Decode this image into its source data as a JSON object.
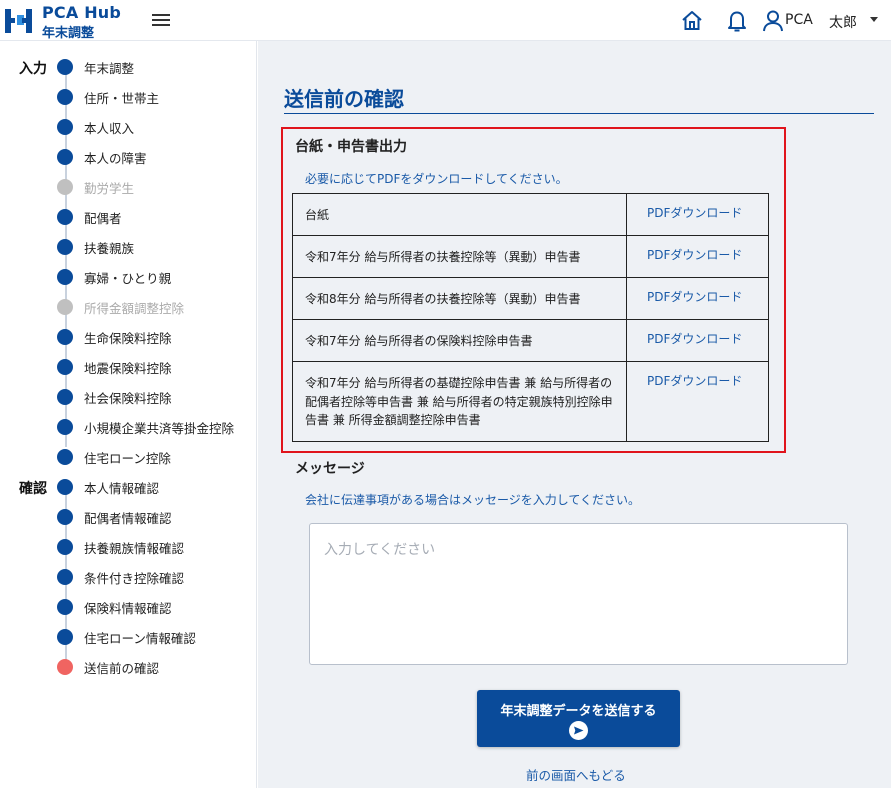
{
  "header": {
    "brand_title": "PCA Hub",
    "brand_sub": "年末調整",
    "user_name": "PCA",
    "user_role": "太郎"
  },
  "sidebar": {
    "section_input": "入力",
    "section_confirm": "確認",
    "input_steps": [
      {
        "label": "年末調整",
        "state": "done"
      },
      {
        "label": "住所・世帯主",
        "state": "done"
      },
      {
        "label": "本人収入",
        "state": "done"
      },
      {
        "label": "本人の障害",
        "state": "done"
      },
      {
        "label": "勤労学生",
        "state": "disabled"
      },
      {
        "label": "配偶者",
        "state": "done"
      },
      {
        "label": "扶養親族",
        "state": "done"
      },
      {
        "label": "寡婦・ひとり親",
        "state": "done"
      },
      {
        "label": "所得金額調整控除",
        "state": "disabled"
      },
      {
        "label": "生命保険料控除",
        "state": "done"
      },
      {
        "label": "地震保険料控除",
        "state": "done"
      },
      {
        "label": "社会保険料控除",
        "state": "done"
      },
      {
        "label": "小規模企業共済等掛金控除",
        "state": "done"
      },
      {
        "label": "住宅ローン控除",
        "state": "done"
      }
    ],
    "confirm_steps": [
      {
        "label": "本人情報確認",
        "state": "done"
      },
      {
        "label": "配偶者情報確認",
        "state": "done"
      },
      {
        "label": "扶養親族情報確認",
        "state": "done"
      },
      {
        "label": "条件付き控除確認",
        "state": "done"
      },
      {
        "label": "保険料情報確認",
        "state": "done"
      },
      {
        "label": "住宅ローン情報確認",
        "state": "done"
      },
      {
        "label": "送信前の確認",
        "state": "current"
      }
    ]
  },
  "main": {
    "page_title": "送信前の確認",
    "output_section": {
      "heading": "台紙・申告書出力",
      "description": "必要に応じてPDFをダウンロードしてください。",
      "rows": [
        {
          "name": "台紙",
          "link": "PDFダウンロード"
        },
        {
          "name": "令和7年分 給与所得者の扶養控除等（異動）申告書",
          "link": "PDFダウンロード"
        },
        {
          "name": "令和8年分 給与所得者の扶養控除等（異動）申告書",
          "link": "PDFダウンロード"
        },
        {
          "name": "令和7年分 給与所得者の保険料控除申告書",
          "link": "PDFダウンロード"
        },
        {
          "name": "令和7年分 給与所得者の基礎控除申告書 兼 給与所得者の配偶者控除等申告書 兼 給与所得者の特定親族特別控除申告書 兼 所得金額調整控除申告書",
          "link": "PDFダウンロード"
        }
      ]
    },
    "message_section": {
      "heading": "メッセージ",
      "description": "会社に伝達事項がある場合はメッセージを入力してください。",
      "placeholder": "入力してください",
      "value": ""
    },
    "send_button_label": "年末調整データを送信する",
    "back_link": "前の画面へもどる"
  },
  "colors": {
    "brand": "#0a4b9a",
    "link": "#1a5aa8",
    "highlight_border": "#e0141c",
    "current_step": "#f06461",
    "disabled_step": "#c0c0c0",
    "main_bg": "#eef1f5"
  },
  "icons": {
    "logo": "pca-logo-icon",
    "menu": "hamburger-menu-icon",
    "home": "home-icon",
    "notifications": "bell-icon",
    "user": "user-icon",
    "dropdown": "caret-down-icon",
    "send": "send-arrow-icon"
  }
}
